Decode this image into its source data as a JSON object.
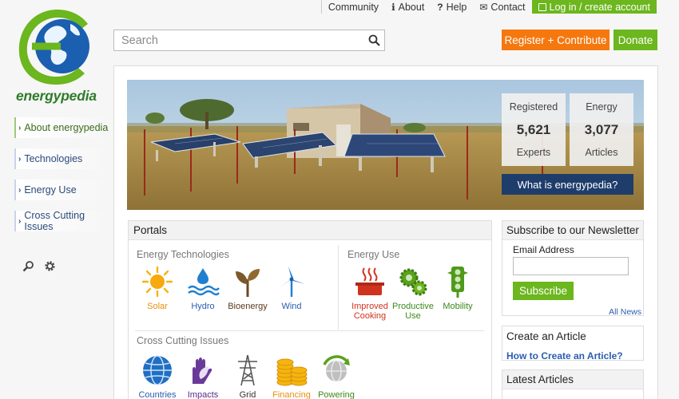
{
  "topbar": {
    "community": "Community",
    "about": "About",
    "help": "Help",
    "contact": "Contact",
    "login": "Log in / create account"
  },
  "logo": {
    "wordmark": "energypedia"
  },
  "search": {
    "placeholder": "Search"
  },
  "header": {
    "register": "Register + Contribute",
    "donate": "Donate"
  },
  "sidebar": {
    "items": [
      {
        "label": "About energypedia"
      },
      {
        "label": "Technologies"
      },
      {
        "label": "Energy Use"
      },
      {
        "label": "Cross Cutting Issues"
      }
    ]
  },
  "hero": {
    "stat1": {
      "top": "Registered",
      "value": "5,621",
      "bottom": "Experts"
    },
    "stat2": {
      "top": "Energy",
      "value": "3,077",
      "bottom": "Articles"
    },
    "what_button": "What is energypedia?"
  },
  "portals": {
    "title": "Portals",
    "energy_technologies": {
      "title": "Energy Technologies",
      "items": [
        {
          "label": "Solar",
          "icon": "sun-icon"
        },
        {
          "label": "Hydro",
          "icon": "water-icon"
        },
        {
          "label": "Bioenergy",
          "icon": "plant-icon"
        },
        {
          "label": "Wind",
          "icon": "wind-turbine-icon"
        }
      ]
    },
    "energy_use": {
      "title": "Energy Use",
      "items": [
        {
          "label": "Improved Cooking",
          "icon": "cooking-pot-icon"
        },
        {
          "label": "Productive Use",
          "icon": "gears-icon"
        },
        {
          "label": "Mobility",
          "icon": "traffic-light-icon"
        }
      ]
    },
    "cross_cutting": {
      "title": "Cross Cutting Issues",
      "items": [
        {
          "label": "Countries",
          "icon": "globe-icon"
        },
        {
          "label": "Impacts",
          "icon": "hand-leaf-icon"
        },
        {
          "label": "Grid",
          "icon": "power-pylon-icon"
        },
        {
          "label": "Financing",
          "icon": "coins-icon"
        },
        {
          "label": "Powering",
          "icon": "globe-arrow-icon"
        }
      ]
    }
  },
  "newsletter": {
    "title": "Subscribe to our Newsletter",
    "email_label": "Email Address",
    "email_value": "",
    "subscribe": "Subscribe",
    "all_news": "All News"
  },
  "create_article": {
    "title": "Create an Article",
    "link": "How to Create an Article?"
  },
  "latest": {
    "title": "Latest Articles"
  },
  "colors": {
    "green": "#6cb61e",
    "orange": "#f5780f",
    "navy": "#1e3d6b",
    "link_blue": "#2a5db0",
    "solar_label": "#e8900c",
    "hydro_label": "#2a5db0",
    "bioenergy_label": "#5a3a1a",
    "cooking_label": "#d0331d",
    "productive_label": "#3a8a1a"
  }
}
